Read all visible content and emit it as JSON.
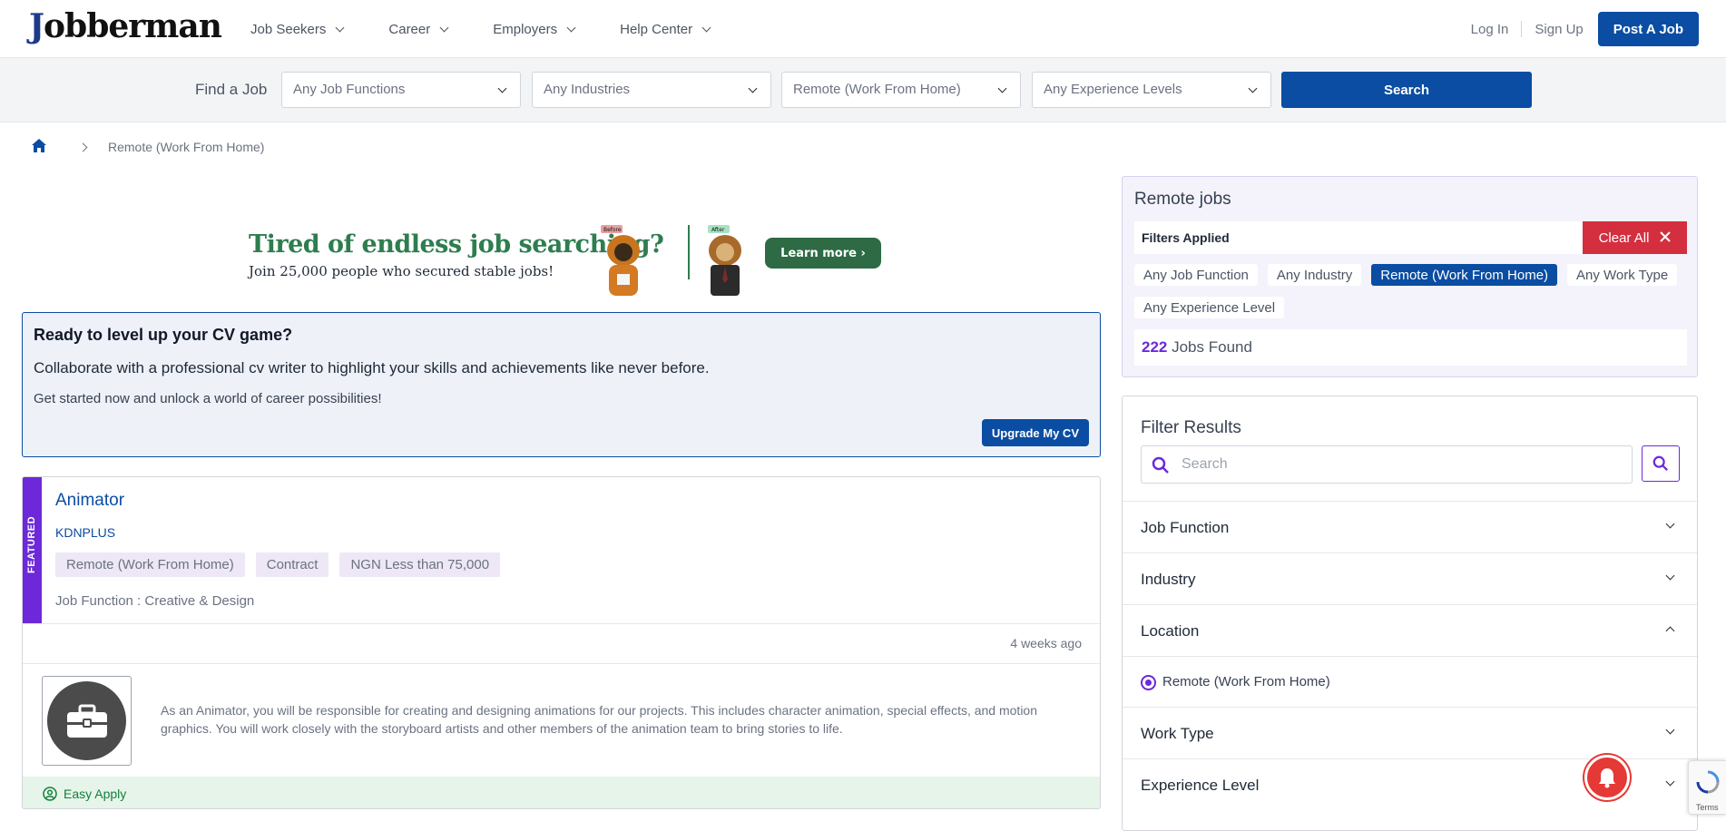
{
  "brand": {
    "logo_text": "Jobberman",
    "logo_initial": "J",
    "logo_rest": "obberman"
  },
  "nav": {
    "items": [
      {
        "label": "Job Seekers"
      },
      {
        "label": "Career"
      },
      {
        "label": "Employers"
      },
      {
        "label": "Help Center"
      }
    ]
  },
  "auth": {
    "login": "Log In",
    "signup": "Sign Up",
    "post_job": "Post A Job"
  },
  "search": {
    "find_label": "Find a Job",
    "job_functions": "Any Job Functions",
    "industries": "Any Industries",
    "location": "Remote (Work From Home)",
    "experience": "Any Experience Levels",
    "button": "Search"
  },
  "breadcrumb": {
    "current": "Remote (Work From Home)"
  },
  "banner": {
    "title": "Tired of endless job searching?",
    "subtitle": "Join 25,000 people who secured stable jobs!",
    "cta": "Learn more",
    "before_label": "Before",
    "after_label": "After"
  },
  "cv_promo": {
    "title": "Ready to level up your CV game?",
    "lead": "Collaborate with a professional cv writer to highlight your skills and achievements like never before.",
    "sub": "Get started now and unlock a world of career possibilities!",
    "button": "Upgrade My CV"
  },
  "job": {
    "featured_label": "FEATURED",
    "title": "Animator",
    "company": "KDNPLUS",
    "tags": [
      "Remote (Work From Home)",
      "Contract",
      "NGN Less than 75,000"
    ],
    "job_function": "Job Function : Creative & Design",
    "posted": "4 weeks ago",
    "description": "As an Animator, you will be responsible for creating and designing animations for our projects. This includes character animation, special effects, and motion graphics. You will work closely with the storyboard artists and other members of the animation team to bring stories to life.",
    "easy_apply": "Easy Apply"
  },
  "filters": {
    "title": "Remote jobs",
    "applied_label": "Filters Applied",
    "clear_label": "Clear All",
    "chips": [
      {
        "label": "Any Job Function",
        "active": false
      },
      {
        "label": "Any Industry",
        "active": false
      },
      {
        "label": "Remote (Work From Home)",
        "active": true
      },
      {
        "label": "Any Work Type",
        "active": false
      },
      {
        "label": "Any Experience Level",
        "active": false
      }
    ],
    "count": "222",
    "count_suffix": " Jobs Found"
  },
  "results": {
    "title": "Filter Results",
    "search_placeholder": "Search",
    "sections": {
      "job_function": "Job Function",
      "industry": "Industry",
      "location": "Location",
      "location_option": "Remote (Work From Home)",
      "work_type": "Work Type",
      "experience": "Experience Level"
    }
  },
  "recaptcha": {
    "terms": "Terms"
  },
  "colors": {
    "primary": "#0a4da2",
    "accent": "#6d28d9",
    "danger": "#d32f3f",
    "success": "#15803d"
  }
}
